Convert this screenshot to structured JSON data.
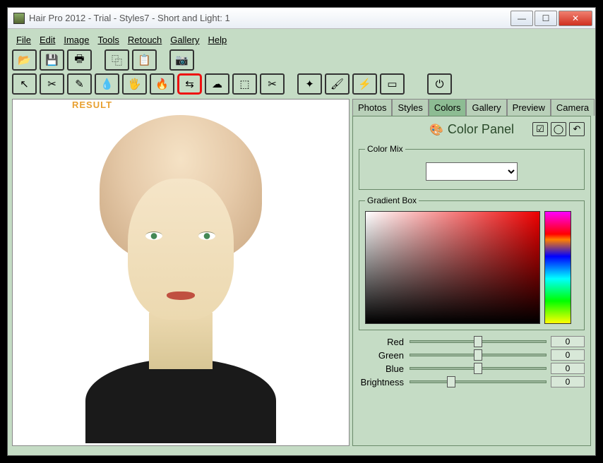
{
  "window": {
    "title": "Hair Pro 2012 - Trial - Styles7 - Short and Light: 1"
  },
  "menu": {
    "file": "File",
    "edit": "Edit",
    "image": "Image",
    "tools": "Tools",
    "retouch": "Retouch",
    "gallery": "Gallery",
    "help": "Help"
  },
  "canvas": {
    "brand": "RESULT"
  },
  "tabs": {
    "photos": "Photos",
    "styles": "Styles",
    "colors": "Colors",
    "gallery": "Gallery",
    "preview": "Preview",
    "camera": "Camera"
  },
  "colorPanel": {
    "title": "Color Panel",
    "colorMix": "Color Mix",
    "gradientBox": "Gradient Box",
    "sliders": {
      "red": {
        "label": "Red",
        "value": "0"
      },
      "green": {
        "label": "Green",
        "value": "0"
      },
      "blue": {
        "label": "Blue",
        "value": "0"
      },
      "brightness": {
        "label": "Brightness",
        "value": "0"
      }
    }
  }
}
